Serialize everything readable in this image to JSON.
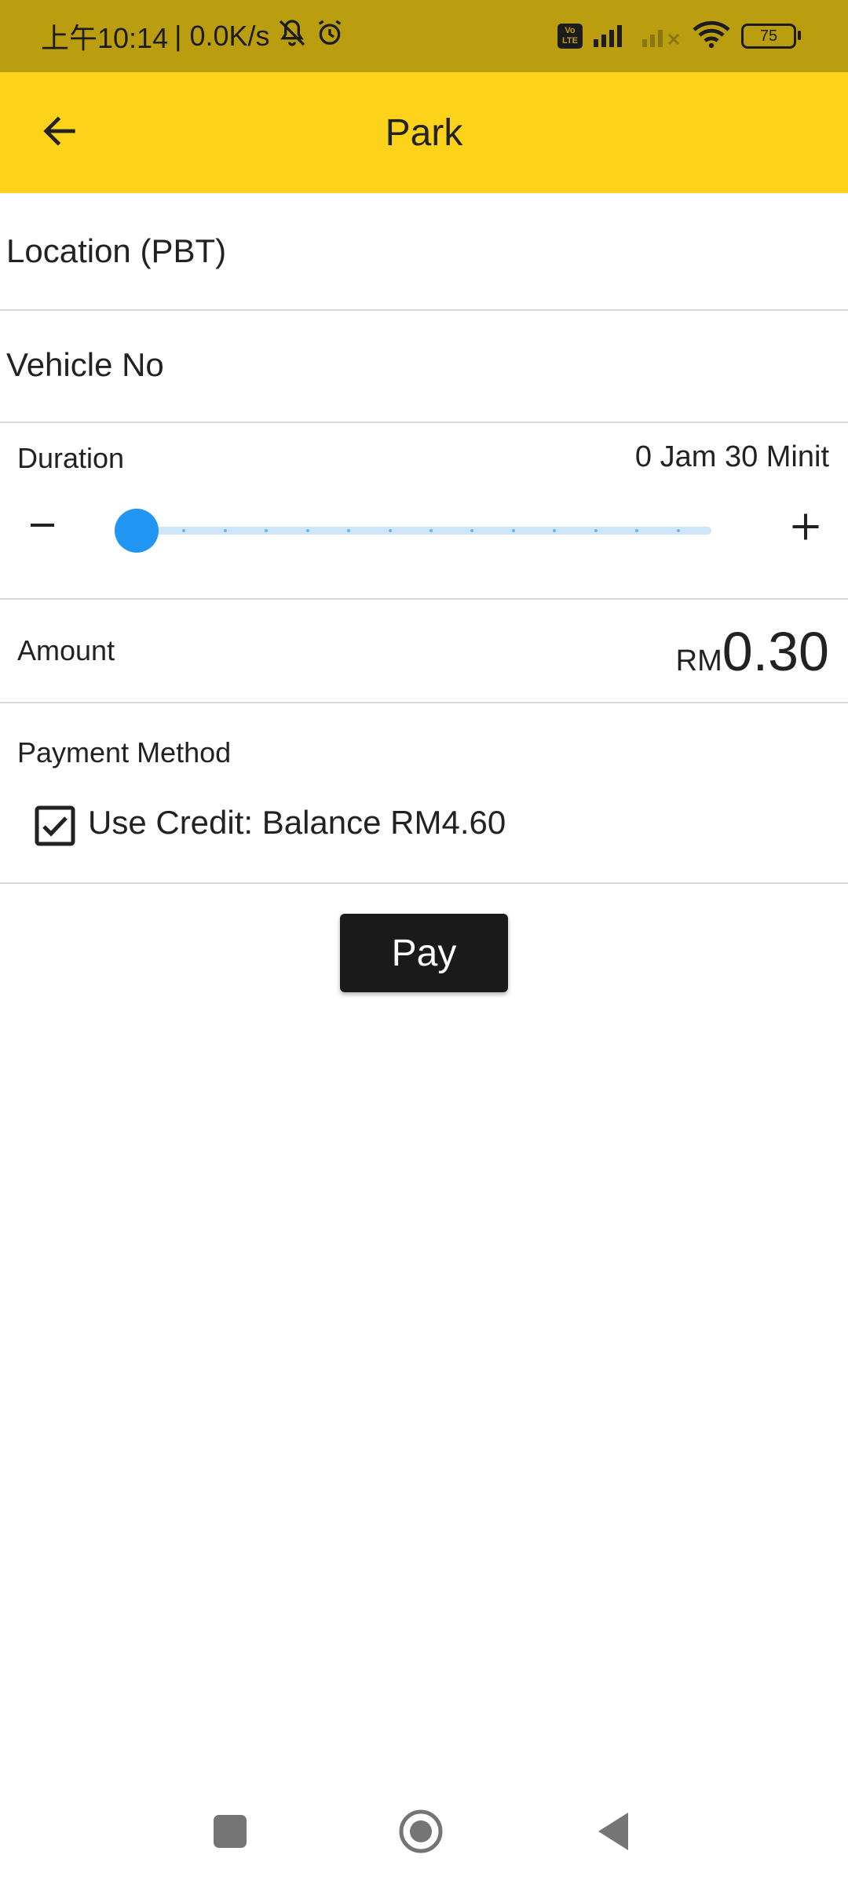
{
  "status_bar": {
    "time": "上午10:14",
    "net_speed": "| 0.0K/s",
    "volte_top": "Vo",
    "volte_bottom": "LTE",
    "battery": "75",
    "icons": [
      "mute-icon",
      "alarm-icon",
      "volte-icon",
      "signal-icon",
      "signal-no-service-icon",
      "wifi-icon",
      "battery-icon"
    ]
  },
  "app_bar": {
    "title": "Park",
    "back_icon": "arrow-left-icon",
    "background": "#fdd21a"
  },
  "form": {
    "location_label": "Location (PBT)",
    "vehicle_label": "Vehicle No",
    "duration": {
      "label": "Duration",
      "value": "0 Jam 30 Minit",
      "slider_position": 0,
      "slider_steps": 14
    },
    "amount": {
      "label": "Amount",
      "currency": "RM",
      "value": "0.30"
    },
    "payment": {
      "label": "Payment Method",
      "use_credit_checked": true,
      "use_credit_label": "Use Credit: Balance RM4.60"
    },
    "pay_button": "Pay"
  },
  "colors": {
    "accent": "#2196f3",
    "appbar": "#fdd21a",
    "statusbar": "#bb9e10",
    "button": "#1a1a1a"
  },
  "nav_bar": {
    "icons": [
      "recents-square-icon",
      "home-circle-icon",
      "back-triangle-icon"
    ]
  }
}
